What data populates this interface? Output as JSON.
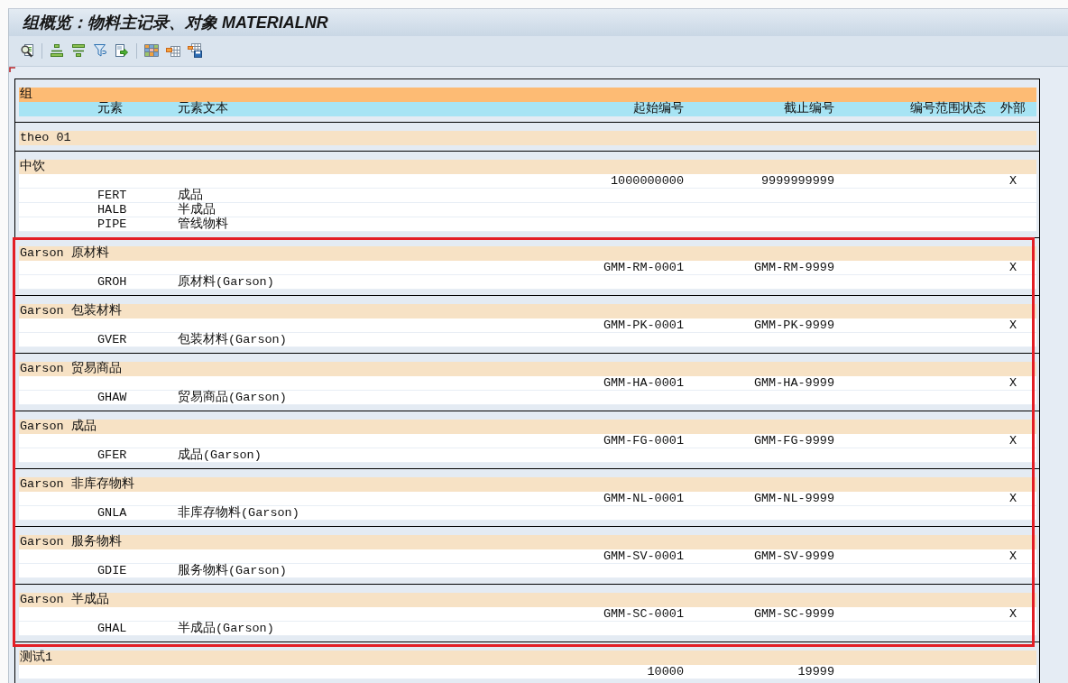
{
  "window": {
    "title": "组概览：物料主记录、对象 MATERIALNR"
  },
  "list": {
    "header": {
      "group": "组",
      "columns": [
        "元素",
        "元素文本",
        "起始编号",
        "截止编号",
        "编号范围状态",
        "外部"
      ]
    },
    "groups": [
      {
        "name": "theo 01",
        "highlighted": false
      },
      {
        "name": "中饮",
        "highlighted": false,
        "range": {
          "from": "1000000000",
          "to": "9999999999",
          "external": "X"
        },
        "elements": [
          {
            "code": "FERT",
            "text": "成品"
          },
          {
            "code": "HALB",
            "text": "半成品"
          },
          {
            "code": "PIPE",
            "text": "管线物料"
          }
        ]
      },
      {
        "name": "Garson 原材料",
        "highlighted": true,
        "range": {
          "from": "GMM-RM-0001",
          "to": "GMM-RM-9999",
          "external": "X"
        },
        "elements": [
          {
            "code": "GROH",
            "text": "原材料(Garson)"
          }
        ]
      },
      {
        "name": "Garson 包装材料",
        "highlighted": true,
        "range": {
          "from": "GMM-PK-0001",
          "to": "GMM-PK-9999",
          "external": "X"
        },
        "elements": [
          {
            "code": "GVER",
            "text": "包装材料(Garson)"
          }
        ]
      },
      {
        "name": "Garson 贸易商品",
        "highlighted": true,
        "range": {
          "from": "GMM-HA-0001",
          "to": "GMM-HA-9999",
          "external": "X"
        },
        "elements": [
          {
            "code": "GHAW",
            "text": "贸易商品(Garson)"
          }
        ]
      },
      {
        "name": "Garson 成品",
        "highlighted": true,
        "range": {
          "from": "GMM-FG-0001",
          "to": "GMM-FG-9999",
          "external": "X"
        },
        "elements": [
          {
            "code": "GFER",
            "text": "成品(Garson)"
          }
        ]
      },
      {
        "name": "Garson 非库存物料",
        "highlighted": true,
        "range": {
          "from": "GMM-NL-0001",
          "to": "GMM-NL-9999",
          "external": "X"
        },
        "elements": [
          {
            "code": "GNLA",
            "text": "非库存物料(Garson)"
          }
        ]
      },
      {
        "name": "Garson 服务物料",
        "highlighted": true,
        "range": {
          "from": "GMM-SV-0001",
          "to": "GMM-SV-9999",
          "external": "X"
        },
        "elements": [
          {
            "code": "GDIE",
            "text": "服务物料(Garson)"
          }
        ]
      },
      {
        "name": "Garson 半成品",
        "highlighted": true,
        "range": {
          "from": "GMM-SC-0001",
          "to": "GMM-SC-9999",
          "external": "X"
        },
        "elements": [
          {
            "code": "GHAL",
            "text": "半成品(Garson)"
          }
        ]
      },
      {
        "name": "测试1",
        "highlighted": false,
        "range": {
          "from": "10000",
          "to": "19999"
        }
      }
    ]
  }
}
